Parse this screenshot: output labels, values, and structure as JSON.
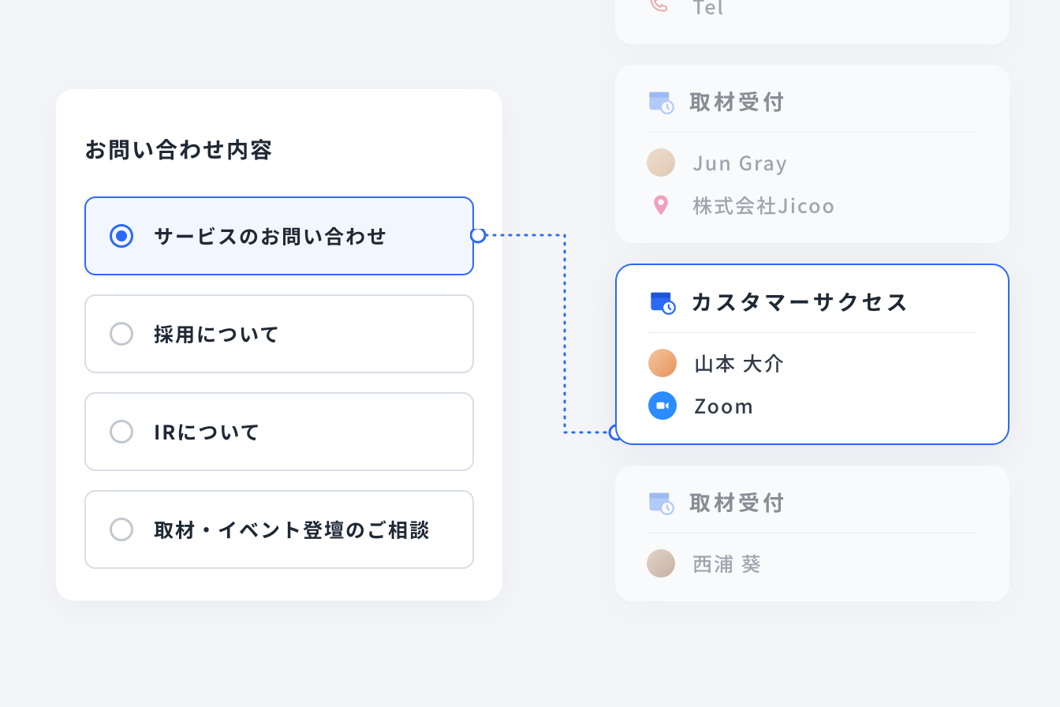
{
  "inquiry": {
    "title": "お問い合わせ内容",
    "options": [
      {
        "label": "サービスのお問い合わせ",
        "selected": true
      },
      {
        "label": "採用について",
        "selected": false
      },
      {
        "label": "IRについて",
        "selected": false
      },
      {
        "label": "取材・イベント登壇のご相談",
        "selected": false
      }
    ]
  },
  "cards": [
    {
      "title_visible": false,
      "rows": [
        {
          "kind": "phone",
          "text": "Tel"
        }
      ],
      "active": false
    },
    {
      "title": "取材受付",
      "rows": [
        {
          "kind": "avatar",
          "text": "Jun Gray"
        },
        {
          "kind": "pin",
          "text": "株式会社Jicoo"
        }
      ],
      "active": false
    },
    {
      "title": "カスタマーサクセス",
      "rows": [
        {
          "kind": "avatar",
          "text": "山本 大介"
        },
        {
          "kind": "zoom",
          "text": "Zoom"
        }
      ],
      "active": true
    },
    {
      "title": "取材受付",
      "rows": [
        {
          "kind": "avatar",
          "text": "西浦 葵"
        }
      ],
      "active": false
    }
  ]
}
